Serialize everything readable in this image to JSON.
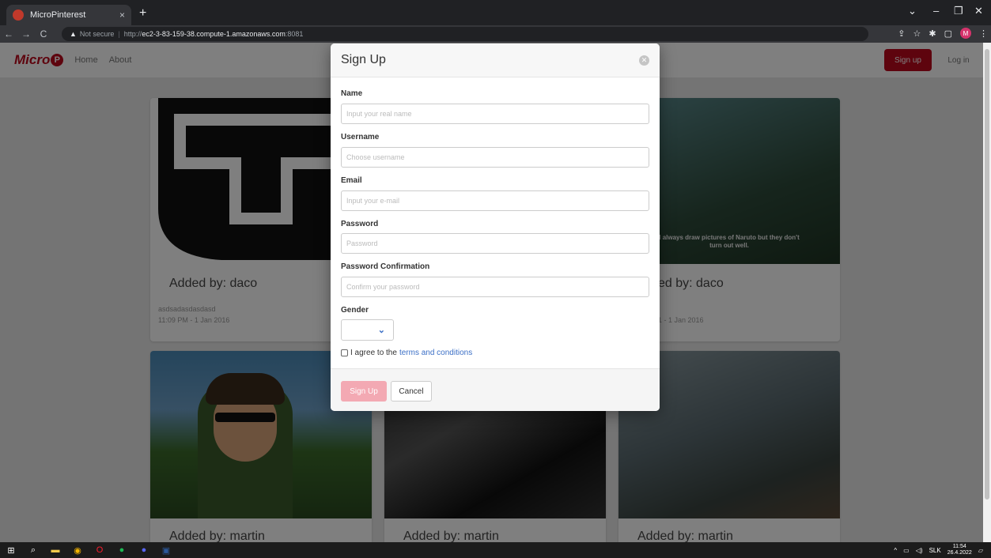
{
  "browser": {
    "tab_title": "MicroPinterest",
    "tab_close": "×",
    "new_tab": "+",
    "security_label": "Not secure",
    "url_scheme": "http://",
    "url_host": "ec2-3-83-159-38.compute-1.amazonaws.com",
    "url_port": ":8081",
    "profile_initial": "M"
  },
  "site": {
    "brand": "Micro",
    "brand_p": "P",
    "nav": {
      "home": "Home",
      "about": "About"
    },
    "signup_button": "Sign up",
    "login_button": "Log in"
  },
  "cards": [
    {
      "added": "Added by: daco",
      "desc": "asdsadasdasdasd",
      "date": "11:09 PM - 1 Jan 2016"
    },
    {
      "added": "ed by: daco",
      "date": "1 - 1 Jan 2016",
      "caption": "I always draw pictures of Naruto but they don't turn out well."
    },
    {
      "added": "Added by: martin"
    },
    {
      "added": "Added by: martin"
    },
    {
      "added": "Added by: martin"
    }
  ],
  "modal": {
    "title": "Sign Up",
    "fields": {
      "name_label": "Name",
      "name_placeholder": "Input your real name",
      "username_label": "Username",
      "username_placeholder": "Choose username",
      "email_label": "Email",
      "email_placeholder": "Input your e-mail",
      "password_label": "Password",
      "password_placeholder": "Password",
      "confirm_label": "Password Confirmation",
      "confirm_placeholder": "Confirm your password",
      "gender_label": "Gender"
    },
    "terms_prefix": "I agree to the",
    "terms_link": "terms and conditions",
    "submit": "Sign Up",
    "cancel": "Cancel"
  },
  "taskbar": {
    "language": "SLK",
    "time": "11:54",
    "date": "26.4.2022"
  },
  "colors": {
    "brand": "#bd081c",
    "link": "#3b6fc6",
    "disabled_submit": "#f3a9b3"
  }
}
